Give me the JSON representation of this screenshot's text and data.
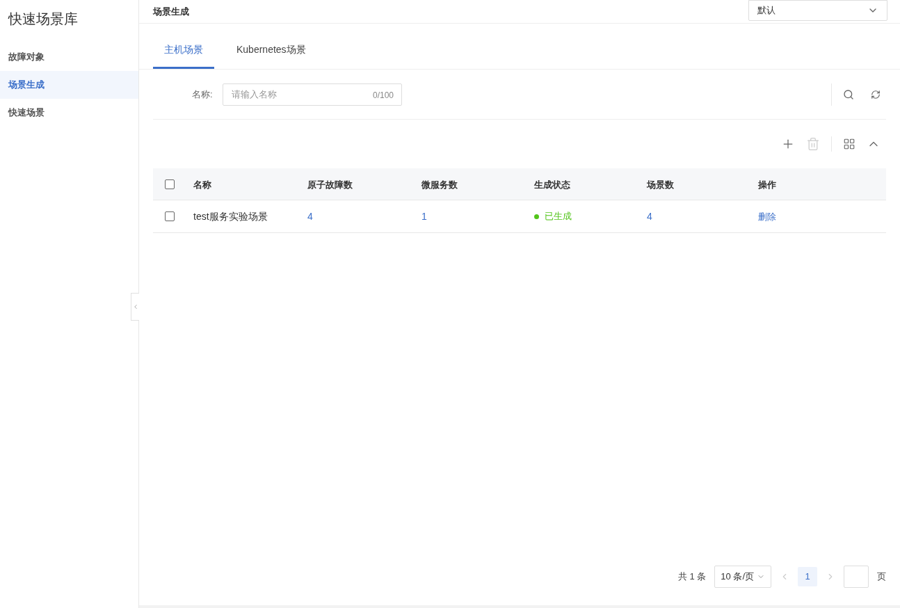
{
  "sidebar": {
    "title": "快速场景库",
    "items": [
      {
        "label": "故障对象",
        "selected": false
      },
      {
        "label": "场景生成",
        "selected": true
      },
      {
        "label": "快速场景",
        "selected": false
      }
    ]
  },
  "header": {
    "title": "场景生成",
    "select": {
      "value": "默认"
    }
  },
  "tabs": [
    {
      "label": "主机场景",
      "selected": true
    },
    {
      "label": "Kubernetes场景",
      "selected": false
    }
  ],
  "filter": {
    "label": "名称:",
    "placeholder": "请输入名称",
    "counter": "0/100"
  },
  "table": {
    "columns": [
      "名称",
      "原子故障数",
      "微服务数",
      "生成状态",
      "场景数",
      "操作"
    ],
    "all_checked": false,
    "rows": [
      {
        "checked": false,
        "name": "test服务实验场景",
        "atomic_faults": "4",
        "microservices": "1",
        "status": "已生成",
        "color": "#52c41a",
        "scenes": "4",
        "action": "删除"
      }
    ]
  },
  "pagination": {
    "total": "共 1 条",
    "page_size": "10 条/页",
    "pages": [
      {
        "label": "1",
        "selected": true
      }
    ],
    "goto_suffix": "页"
  }
}
